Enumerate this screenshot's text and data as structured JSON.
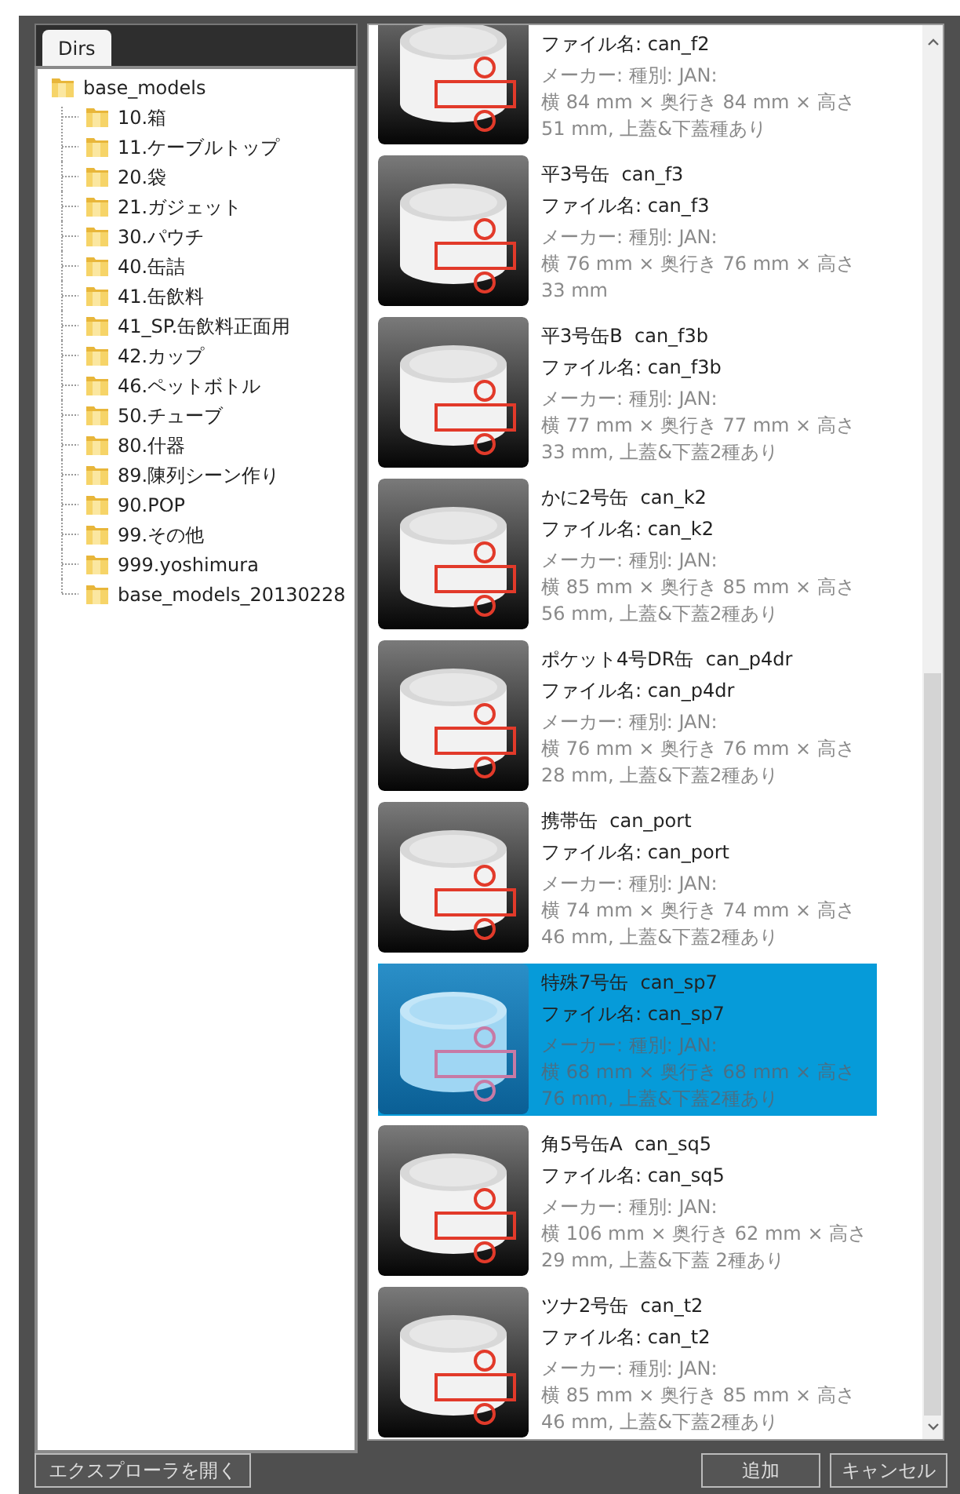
{
  "tab": {
    "label": "Dirs",
    "selected": true
  },
  "tree": {
    "label": "base_models",
    "children": [
      {
        "label": "10.箱"
      },
      {
        "label": "11.ケーブルトップ"
      },
      {
        "label": "20.袋"
      },
      {
        "label": "21.ガジェット"
      },
      {
        "label": "30.パウチ"
      },
      {
        "label": "40.缶詰"
      },
      {
        "label": "41.缶飲料"
      },
      {
        "label": "41_SP.缶飲料正面用"
      },
      {
        "label": "42.カップ"
      },
      {
        "label": "46.ペットボトル"
      },
      {
        "label": "50.チューブ"
      },
      {
        "label": "80.什器"
      },
      {
        "label": "89.陳列シーン作り"
      },
      {
        "label": "90.POP"
      },
      {
        "label": "99.その他"
      },
      {
        "label": "999.yoshimura"
      },
      {
        "label": "base_models_20130228"
      }
    ]
  },
  "items": [
    {
      "filename": "ファイル名: can_f2",
      "maker": "メーカー: 種別: JAN:",
      "dims": "横 84 mm × 奥行き 84 mm × 高さ 51 mm, 上蓋&下蓋種あり",
      "selected": false
    },
    {
      "title": "平3号缶  can_f3",
      "filename": "ファイル名: can_f3",
      "maker": "メーカー: 種別: JAN:",
      "dims": "横 76 mm × 奥行き 76 mm × 高さ 33 mm",
      "selected": false
    },
    {
      "title": "平3号缶B  can_f3b",
      "filename": "ファイル名: can_f3b",
      "maker": "メーカー: 種別: JAN:",
      "dims": "横 77 mm × 奥行き 77 mm × 高さ 33 mm, 上蓋&下蓋2種あり",
      "selected": false
    },
    {
      "title": "かに2号缶  can_k2",
      "filename": "ファイル名: can_k2",
      "maker": "メーカー: 種別: JAN:",
      "dims": "横 85 mm × 奥行き 85 mm × 高さ 56 mm, 上蓋&下蓋2種あり",
      "selected": false
    },
    {
      "title": "ポケット4号DR缶  can_p4dr",
      "filename": "ファイル名: can_p4dr",
      "maker": "メーカー: 種別: JAN:",
      "dims": "横 76 mm × 奥行き 76 mm × 高さ 28 mm, 上蓋&下蓋2種あり",
      "selected": false
    },
    {
      "title": "携帯缶  can_port",
      "filename": "ファイル名: can_port",
      "maker": "メーカー: 種別: JAN:",
      "dims": "横 74 mm × 奥行き 74 mm × 高さ 46 mm, 上蓋&下蓋2種あり",
      "selected": false
    },
    {
      "title": "特殊7号缶  can_sp7",
      "filename": "ファイル名: can_sp7",
      "maker": "メーカー: 種別: JAN:",
      "dims": "横 68 mm × 奥行き 68 mm × 高さ 76 mm, 上蓋&下蓋2種あり",
      "selected": true
    },
    {
      "title": "角5号缶A  can_sq5",
      "filename": "ファイル名: can_sq5",
      "maker": "メーカー: 種別: JAN:",
      "dims": "横 106 mm × 奥行き 62 mm × 高さ 29 mm, 上蓋&下蓋 2種あり",
      "selected": false
    },
    {
      "title": "ツナ2号缶  can_t2",
      "filename": "ファイル名: can_t2",
      "maker": "メーカー: 種別: JAN:",
      "dims": "横 85 mm × 奥行き 85 mm × 高さ 46 mm, 上蓋&下蓋2種あり",
      "selected": false
    }
  ],
  "buttons": {
    "explorer": "エクスプローラを開く",
    "add": "追加",
    "cancel": "キャンセル"
  }
}
